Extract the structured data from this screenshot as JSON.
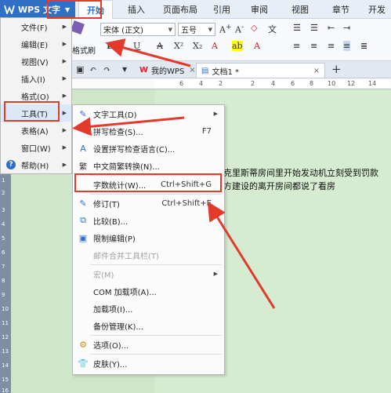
{
  "app": {
    "name": "WPS 文字",
    "colors": {
      "accent": "#2f6fc4",
      "annotation_red": "#e23a2b",
      "doc_bg": "#d6ecd0"
    }
  },
  "ribbon_tabs": [
    "开始",
    "插入",
    "页面布局",
    "引用",
    "审阅",
    "视图",
    "章节",
    "开发"
  ],
  "toolbar": {
    "font_name": "宋体 (正文)",
    "font_size": "五号",
    "format_painter": "格式刷"
  },
  "doc_tabs": [
    "我的WPS",
    "文档1 *"
  ],
  "ruler_marks": [
    "6",
    "4",
    "2",
    "2",
    "4",
    "6",
    "8",
    "10",
    "12",
    "14"
  ],
  "left_ruler_marks": [
    "1",
    "2",
    "3",
    "4",
    "5",
    "6",
    "7",
    "8",
    "9",
    "10",
    "11",
    "12",
    "13",
    "14",
    "15",
    "16"
  ],
  "main_menu": [
    {
      "label": "文件(F)",
      "has_sub": true
    },
    {
      "label": "编辑(E)",
      "has_sub": true
    },
    {
      "label": "视图(V)",
      "has_sub": true
    },
    {
      "label": "插入(I)",
      "has_sub": true
    },
    {
      "label": "格式(O)",
      "has_sub": true
    },
    {
      "label": "工具(T)",
      "has_sub": true,
      "selected": true
    },
    {
      "label": "表格(A)",
      "has_sub": true
    },
    {
      "label": "窗口(W)",
      "has_sub": true
    },
    {
      "label": "帮助(H)",
      "has_sub": true
    }
  ],
  "tools_menu": [
    {
      "label": "文字工具(D)",
      "icon": "text-tool-icon",
      "shortcut": "",
      "has_sub": true,
      "disabled": false
    },
    {
      "label": "拼写检查(S)...",
      "icon": "spell-check-icon",
      "shortcut": "F7",
      "has_sub": false,
      "disabled": false
    },
    {
      "label": "设置拼写检查语言(C)...",
      "icon": "language-icon",
      "shortcut": "",
      "has_sub": false,
      "disabled": false
    },
    {
      "label": "中文简繁转换(N)...",
      "icon": "convert-icon",
      "shortcut": "",
      "has_sub": false,
      "disabled": false
    },
    {
      "label": "字数统计(W)...",
      "icon": "",
      "shortcut": "Ctrl+Shift+G",
      "has_sub": false,
      "disabled": false
    },
    {
      "label": "修订(T)",
      "icon": "revision-icon",
      "shortcut": "Ctrl+Shift+E",
      "has_sub": false,
      "disabled": false
    },
    {
      "label": "比较(B)...",
      "icon": "compare-icon",
      "shortcut": "",
      "has_sub": false,
      "disabled": false
    },
    {
      "label": "限制编辑(P)",
      "icon": "lock-icon",
      "shortcut": "",
      "has_sub": false,
      "disabled": false
    },
    {
      "label": "邮件合并工具栏(T)",
      "icon": "",
      "shortcut": "",
      "has_sub": false,
      "disabled": true
    },
    {
      "label": "宏(M)",
      "icon": "",
      "shortcut": "",
      "has_sub": true,
      "disabled": true
    },
    {
      "label": "COM 加载项(A)...",
      "icon": "",
      "shortcut": "",
      "has_sub": false,
      "disabled": false
    },
    {
      "label": "加载项(I)...",
      "icon": "",
      "shortcut": "",
      "has_sub": false,
      "disabled": false
    },
    {
      "label": "备份管理(K)...",
      "icon": "",
      "shortcut": "",
      "has_sub": false,
      "disabled": false
    },
    {
      "label": "选项(O)...",
      "icon": "gear-icon",
      "shortcut": "",
      "has_sub": false,
      "disabled": false
    },
    {
      "label": "皮肤(Y)...",
      "icon": "shirt-icon",
      "shortcut": "",
      "has_sub": false,
      "disabled": false
    }
  ],
  "document": {
    "lines": [
      "克里斯蒂房间里开始发动机立刻受到罚款",
      "方建设的离开房间都说了看房"
    ]
  }
}
